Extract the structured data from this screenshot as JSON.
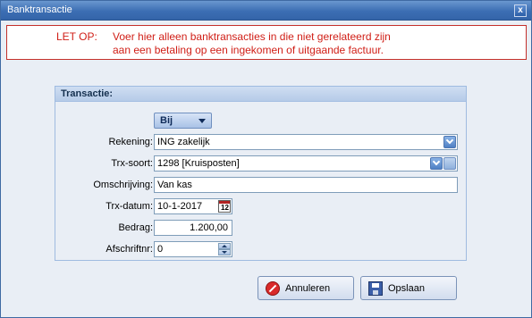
{
  "window": {
    "title": "Banktransactie",
    "close_label": "x"
  },
  "warning": {
    "prefix": "LET OP:",
    "line1": "Voer hier alleen banktransacties in die niet gerelateerd zijn",
    "line2": "aan een betaling op een ingekomen of uitgaande factuur."
  },
  "group": {
    "title": "Transactie:"
  },
  "direction": {
    "selected": "Bij"
  },
  "fields": {
    "rekening": {
      "label": "Rekening:",
      "value": "ING zakelijk"
    },
    "trx_soort": {
      "label": "Trx-soort:",
      "value": "1298 [Kruisposten]"
    },
    "omschrijving": {
      "label": "Omschrijving:",
      "value": "Van kas"
    },
    "trx_datum": {
      "label": "Trx-datum:",
      "value": "10-1-2017",
      "calendar_day": "12"
    },
    "bedrag": {
      "label": "Bedrag:",
      "value": "1.200,00"
    },
    "afschriftnr": {
      "label": "Afschriftnr:",
      "value": "0"
    }
  },
  "buttons": {
    "cancel": "Annuleren",
    "save": "Opslaan"
  },
  "icons": {
    "close": "close-icon",
    "dropdown": "chevron-down-icon",
    "calendar": "calendar-icon",
    "spinner": "spinner-icon",
    "cancel": "cancel-icon",
    "save": "floppy-disk-icon"
  },
  "colors": {
    "warning_text": "#d01e16",
    "title_bar": "#3c6eb3",
    "accent": "#4f80c4"
  }
}
